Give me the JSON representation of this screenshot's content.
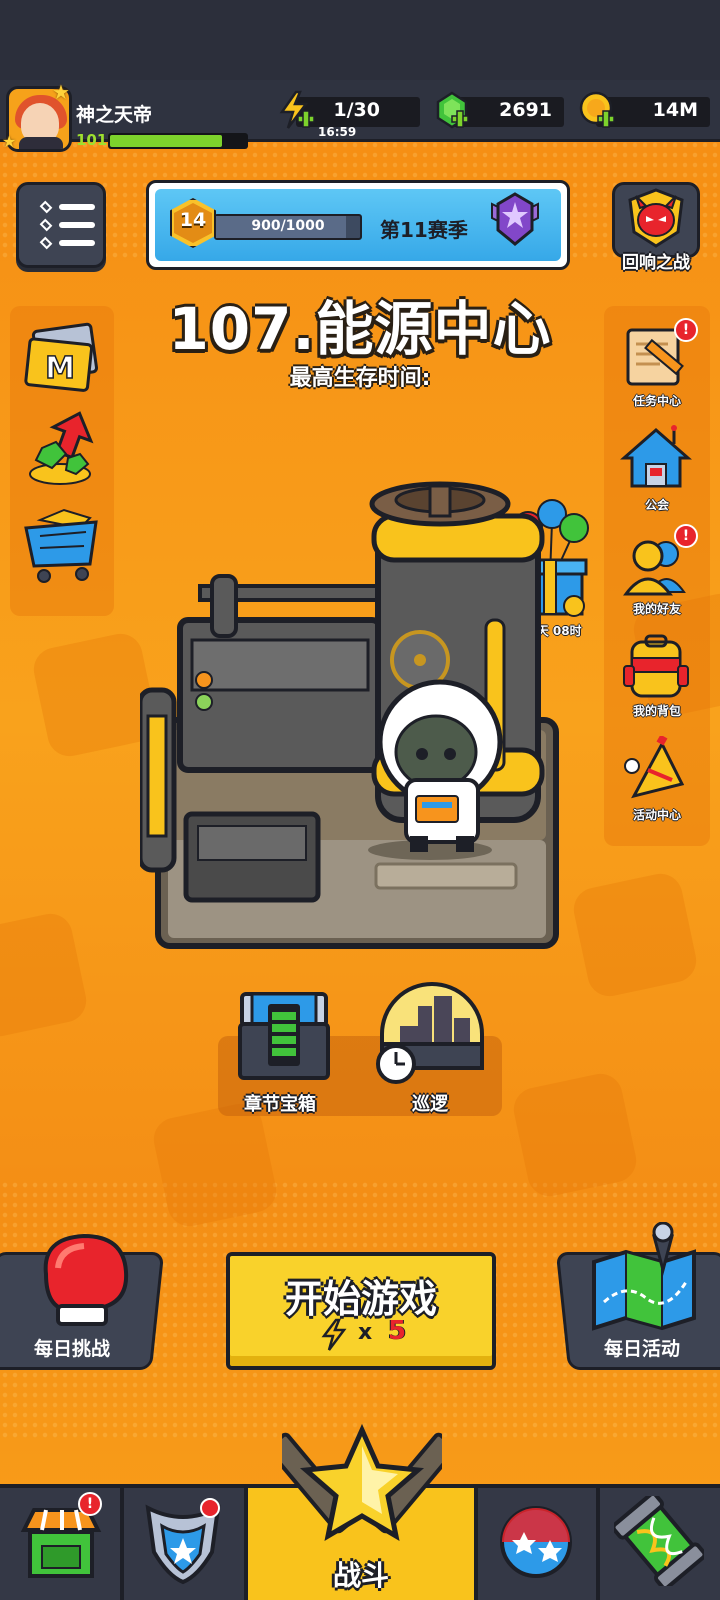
{
  "player": {
    "name": "神之天帝",
    "level": "101",
    "xp_progress": 0.82
  },
  "resources": {
    "energy": {
      "value": "1/30",
      "timer": "16:59",
      "icon": "lightning-plus-icon"
    },
    "gems": {
      "value": "2691",
      "icon": "green-gem-plus-icon"
    },
    "coins": {
      "value": "14M",
      "icon": "gold-coin-plus-icon"
    }
  },
  "season": {
    "rank_level": "14",
    "progress_text": "900/1000",
    "progress": 0.9,
    "title": "第11赛季",
    "badge_icon": "purple-star-wing-badge-icon"
  },
  "echo_battle": {
    "label": "回响之战",
    "icon": "red-devil-mask-icon"
  },
  "stage": {
    "title": "107.能源中心",
    "subtitle": "最高生存时间:"
  },
  "left_shortcuts": [
    {
      "icon": "gold-m-card-icon"
    },
    {
      "icon": "gem-upgrade-arrow-icon"
    },
    {
      "icon": "shopping-cart-gold-icon"
    }
  ],
  "right_shortcuts": [
    {
      "label": "任务中心",
      "icon": "quest-scroll-pencil-icon",
      "badge": "!"
    },
    {
      "label": "公会",
      "icon": "guild-house-icon"
    },
    {
      "label": "我的好友",
      "icon": "friends-icon",
      "badge": "!"
    },
    {
      "label": "我的背包",
      "icon": "backpack-icon"
    },
    {
      "label": "活动中心",
      "icon": "party-horn-icon"
    }
  ],
  "gift": {
    "timer": "02天 08时",
    "icon": "balloon-gift-icon"
  },
  "chapter_chest": {
    "label": "章节宝箱",
    "icon": "blue-chest-icon"
  },
  "patrol": {
    "label": "巡逻",
    "icon": "patrol-clock-icon"
  },
  "daily_challenge": {
    "label": "每日挑战",
    "icon": "boxing-glove-icon"
  },
  "start": {
    "label": "开始游戏",
    "cost_prefix": "x",
    "cost": "5"
  },
  "daily_event": {
    "label": "每日活动",
    "icon": "treasure-map-icon"
  },
  "bottom_nav": [
    {
      "name": "shop",
      "icon": "shop-stall-icon",
      "badge": "!"
    },
    {
      "name": "equipment",
      "icon": "shield-armor-icon"
    },
    {
      "name": "battle",
      "label": "战斗",
      "icon": "crossed-swords-star-icon"
    },
    {
      "name": "talents",
      "icon": "star-orb-icon"
    },
    {
      "name": "evolution",
      "icon": "dna-capsule-icon"
    }
  ],
  "colors": {
    "accent": "#f9c31c",
    "background": "#f7941d",
    "dark": "#2f3340",
    "badge": "#e8242c",
    "xp": "#7dd32c"
  }
}
